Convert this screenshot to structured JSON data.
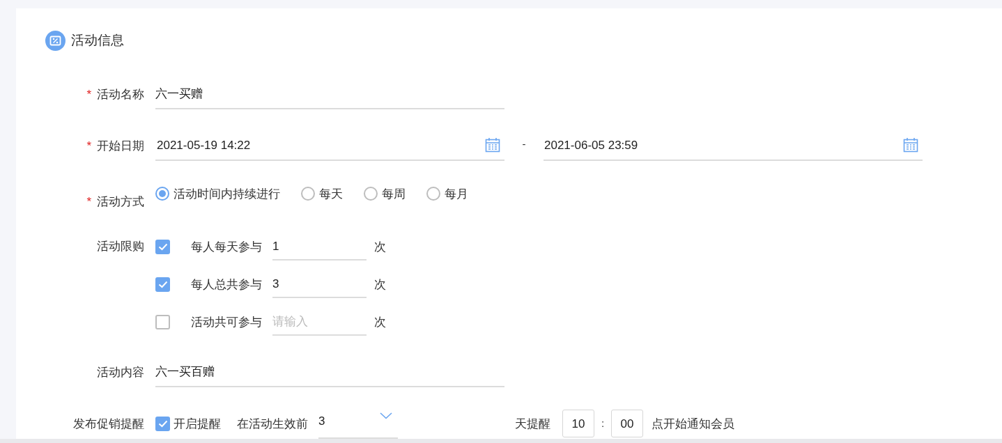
{
  "section": {
    "title": "活动信息"
  },
  "fields": [
    {
      "kind": "text",
      "label": "活动名称",
      "required_mark": "*",
      "value": "六一买赠"
    },
    {
      "kind": "daterange",
      "label": "开始日期",
      "required_mark": "*",
      "start": "2021-05-19 14:22",
      "separator": "-",
      "end": "2021-06-05 23:59"
    },
    {
      "kind": "radio",
      "label": "活动方式",
      "required_mark": "*",
      "options": [
        {
          "label": "活动时间内持续进行",
          "selected": true
        },
        {
          "label": "每天",
          "selected": false
        },
        {
          "label": "每周",
          "selected": false
        },
        {
          "label": "每月",
          "selected": false
        }
      ]
    },
    {
      "kind": "limits",
      "label": "活动限购",
      "rows": [
        {
          "checked": true,
          "label": "每人每天参与",
          "value": "1",
          "unit": "次"
        },
        {
          "checked": true,
          "label": "每人总共参与",
          "value": "3",
          "unit": "次"
        },
        {
          "checked": false,
          "label": "活动共可参与",
          "placeholder": "请输入",
          "unit": "次"
        }
      ]
    },
    {
      "kind": "text",
      "label": "活动内容",
      "value": "六一买百赠"
    },
    {
      "kind": "reminder",
      "label": "发布促销提醒",
      "checkbox": {
        "label": "开启提醒",
        "checked": true
      },
      "prefix": "在活动生效前",
      "days": "3",
      "days_suffix": "天提醒",
      "hour": "10",
      "time_separator": ":",
      "minute": "00",
      "suffix": "点开始通知会员"
    }
  ]
}
